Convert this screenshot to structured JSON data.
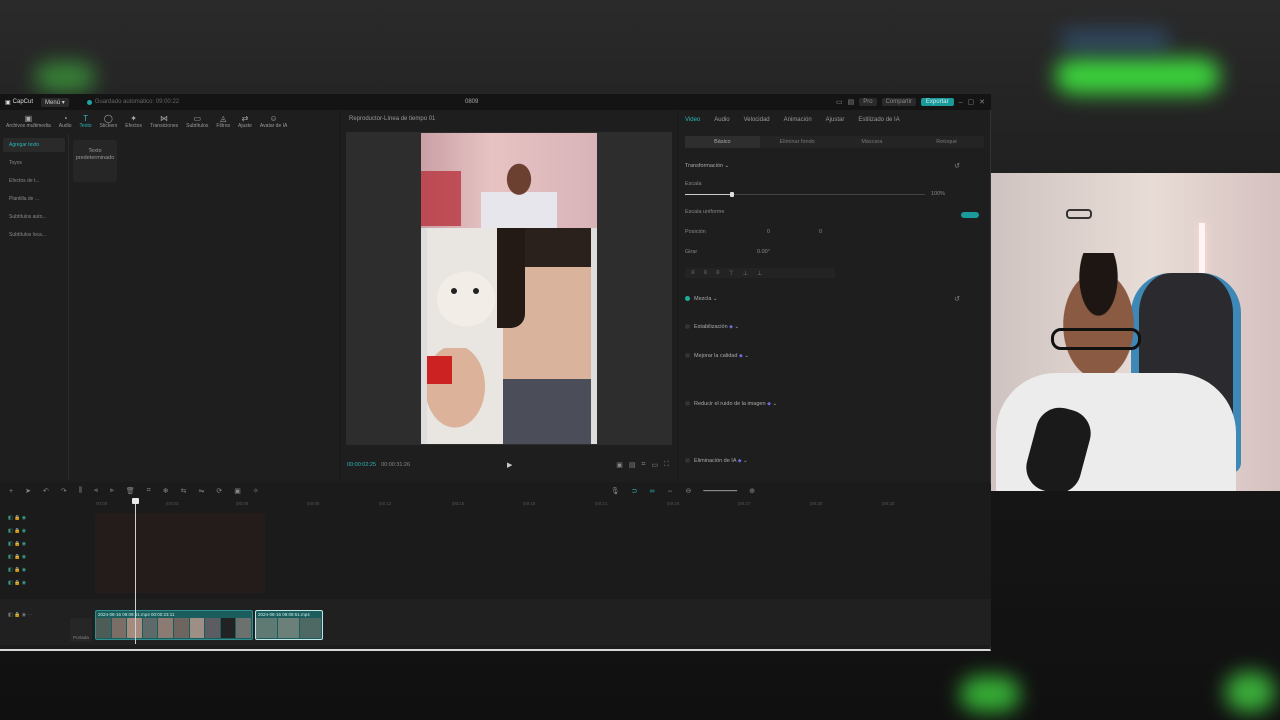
{
  "app": {
    "name": "CapCut",
    "menu_label": "Menú",
    "autosave": "Guardado automático: 09:00:22",
    "project_title": "0809",
    "pro_label": "Pro",
    "share_label": "Compartir",
    "export_label": "Exportar"
  },
  "toolbar": {
    "items": [
      {
        "label": "Archivos multimedia",
        "icon": "media-icon"
      },
      {
        "label": "Audio",
        "icon": "audio-icon"
      },
      {
        "label": "Texto",
        "icon": "text-icon",
        "active": true
      },
      {
        "label": "Stickers",
        "icon": "sticker-icon"
      },
      {
        "label": "Efectos",
        "icon": "effects-icon"
      },
      {
        "label": "Transiciones",
        "icon": "transition-icon"
      },
      {
        "label": "Subtítulos",
        "icon": "subtitle-icon"
      },
      {
        "label": "Filtros",
        "icon": "filter-icon"
      },
      {
        "label": "Ajuste",
        "icon": "adjust-icon"
      },
      {
        "label": "Avatar de IA",
        "icon": "avatar-icon"
      }
    ]
  },
  "leftnav": {
    "items": [
      "Agregar texto",
      "Toyos",
      "Efectos de t...",
      "Plantilla de ...",
      "Subtítulos auto...",
      "Subtítulos loca..."
    ]
  },
  "text_card": {
    "label": "Texto predeterminado"
  },
  "player": {
    "title": "Reproductor-Línea de tiempo 01",
    "current_time": "00:00:02:25",
    "total_time": "00:00:31:26"
  },
  "inspector": {
    "tabs": [
      "Video",
      "Audio",
      "Velocidad",
      "Animación",
      "Ajustar",
      "Estilizado de IA"
    ],
    "subtabs": [
      "Básico",
      "Eliminar fondo",
      "Máscara",
      "Retoque"
    ],
    "transform_label": "Transformación",
    "scale_label": "Escala",
    "scale_value": "100%",
    "uniform_scale_label": "Escala uniforme",
    "position_label": "Posición",
    "pos_x": "0",
    "pos_y": "0",
    "rotate_label": "Girar",
    "rotate_value": "0.00°",
    "blend_label": "Mezcla",
    "stabilize_label": "Estabilización",
    "improve_quality_label": "Mejorar la calidad",
    "noise_label": "Reducir el ruido de la imagen",
    "ai_remove_label": "Eliminación de IA"
  },
  "timeline": {
    "ruler": [
      "00:00",
      "|00:03",
      "|00:06",
      "|00:09",
      "|00:12",
      "|00:15",
      "|00:18",
      "|00:21",
      "|00:24",
      "|00:27",
      "|00:30",
      "|00:33"
    ],
    "cover_label": "Portada",
    "clip1_label": "2024-08-16 09:09:51.mp4  00:00:23:11",
    "clip2_label": "2024-08-16 09:09:51.mp4"
  }
}
